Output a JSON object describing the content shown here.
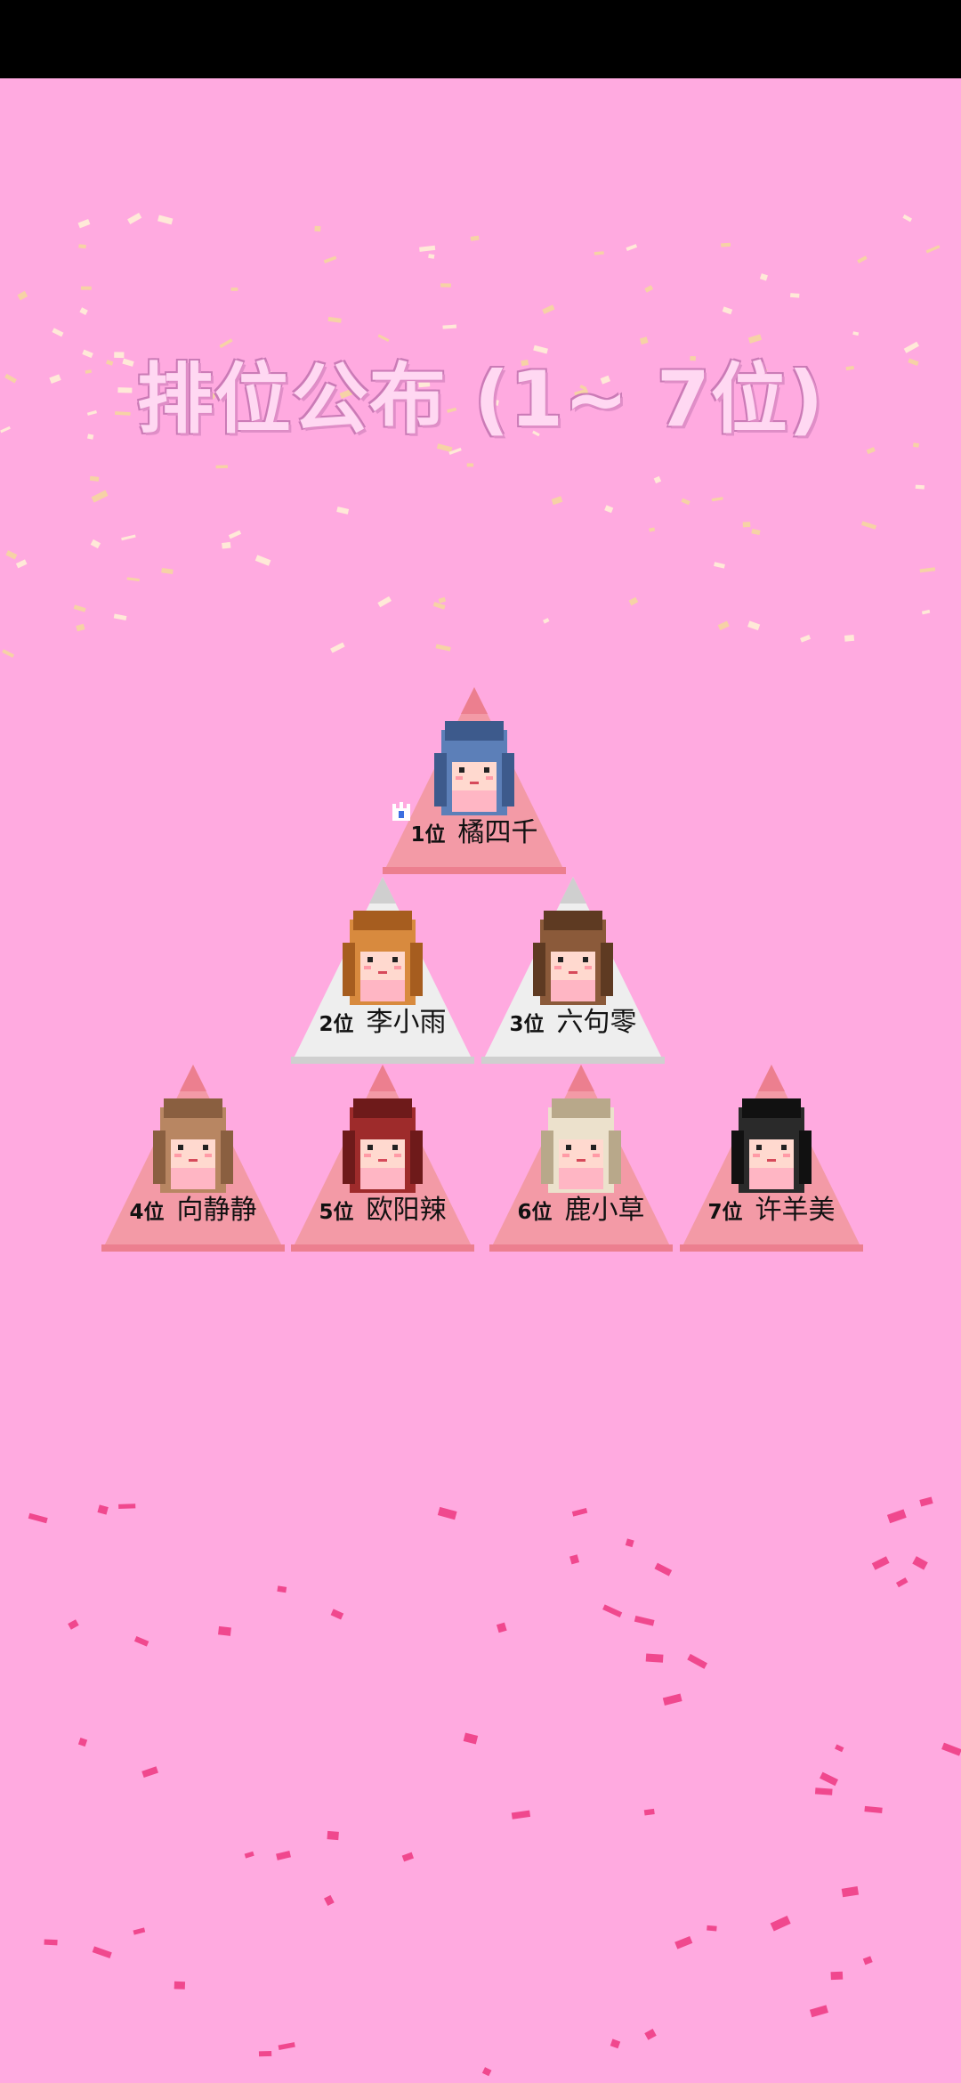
{
  "title": "排位公布 (1~ 7位)",
  "colors": {
    "background": "#ffaae0",
    "pink_triangle": "#f39aa6",
    "white_triangle": "#eeeeee",
    "title_text": "#ffd8f2"
  },
  "rankings": [
    {
      "rank_label": "1位",
      "name": "橘四千",
      "style": "pink",
      "hair": "#5c7fb8",
      "hair_dark": "#3d5a8c",
      "icon": "crown-icon"
    },
    {
      "rank_label": "2位",
      "name": "李小雨",
      "style": "white",
      "hair": "#d88a3e",
      "hair_dark": "#a65d1f"
    },
    {
      "rank_label": "3位",
      "name": "六句零",
      "style": "white",
      "hair": "#8b5a3a",
      "hair_dark": "#5e3a22"
    },
    {
      "rank_label": "4位",
      "name": "向静静",
      "style": "pink",
      "hair": "#b88662",
      "hair_dark": "#8a5f40"
    },
    {
      "rank_label": "5位",
      "name": "欧阳辣",
      "style": "pink",
      "hair": "#9e2b2b",
      "hair_dark": "#6e1a1a"
    },
    {
      "rank_label": "6位",
      "name": "鹿小草",
      "style": "pink",
      "hair": "#ece1cc",
      "hair_dark": "#b8a88a"
    },
    {
      "rank_label": "7位",
      "name": "许羊美",
      "style": "pink",
      "hair": "#2a2a2a",
      "hair_dark": "#111111"
    }
  ]
}
